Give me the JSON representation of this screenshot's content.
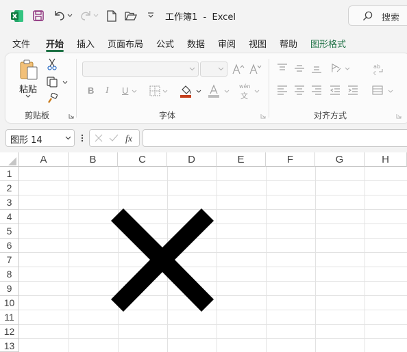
{
  "titlebar": {
    "title": "工作簿1  -  Excel",
    "search_placeholder": "搜索"
  },
  "tabs": [
    {
      "label": "文件",
      "active": false
    },
    {
      "label": "开始",
      "active": true
    },
    {
      "label": "插入",
      "active": false
    },
    {
      "label": "页面布局",
      "active": false
    },
    {
      "label": "公式",
      "active": false
    },
    {
      "label": "数据",
      "active": false
    },
    {
      "label": "审阅",
      "active": false
    },
    {
      "label": "视图",
      "active": false
    },
    {
      "label": "帮助",
      "active": false
    },
    {
      "label": "图形格式",
      "active": false,
      "contextual": true
    }
  ],
  "ribbon": {
    "clipboard": {
      "paste_label": "粘贴",
      "group_label": "剪贴板"
    },
    "font": {
      "group_label": "字体",
      "font_name": "",
      "font_size": "",
      "bold": "B",
      "italic": "I",
      "underline": "U",
      "phonetic_top": "wén",
      "phonetic_bottom": "文"
    },
    "alignment": {
      "group_label": "对齐方式"
    }
  },
  "formula_bar": {
    "name_box": "图形 14",
    "formula": ""
  },
  "sheet": {
    "columns": [
      "A",
      "B",
      "C",
      "D",
      "E",
      "F",
      "G",
      "H"
    ],
    "rows": [
      "1",
      "2",
      "3",
      "4",
      "5",
      "6",
      "7",
      "8",
      "9",
      "10",
      "11",
      "12",
      "13"
    ]
  },
  "shape": {
    "name": "图形 14",
    "type": "cross",
    "color": "#000000"
  },
  "colors": {
    "brand": "#1e7145",
    "font_color_bar": "#c43e1c",
    "fill_color_bar": "#ffc000"
  }
}
